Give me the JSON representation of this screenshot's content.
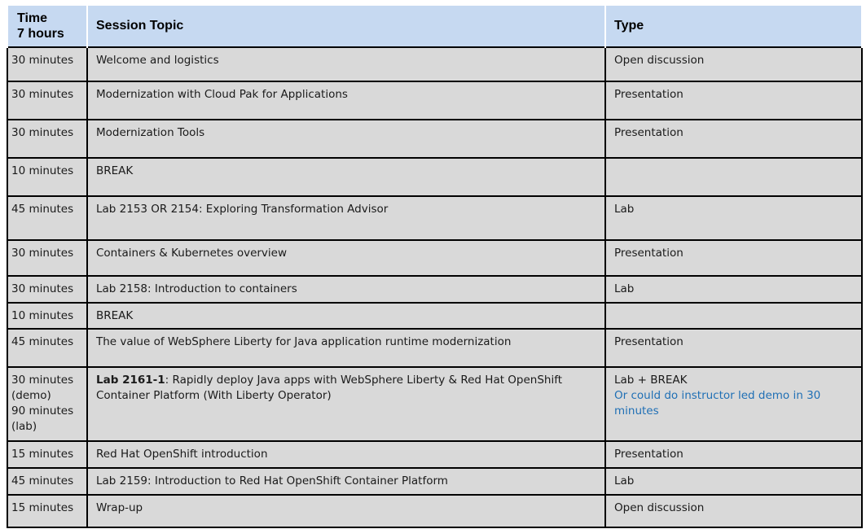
{
  "header": {
    "time_line1": "Time",
    "time_line2": "7 hours",
    "topic": "Session Topic",
    "type": "Type"
  },
  "rows": [
    {
      "time": "30 minutes",
      "topic": "Welcome and logistics",
      "type": "Open discussion"
    },
    {
      "time": "30 minutes",
      "topic": "Modernization with Cloud Pak for Applications",
      "type": "Presentation"
    },
    {
      "time": "30 minutes",
      "topic": "Modernization Tools",
      "type": "Presentation"
    },
    {
      "time": "10 minutes",
      "topic": "BREAK",
      "type": ""
    },
    {
      "time": "45 minutes",
      "topic": "Lab 2153 OR  2154: Exploring Transformation Advisor",
      "type": "Lab"
    },
    {
      "time": "30 minutes",
      "topic": "Containers & Kubernetes overview",
      "type": "Presentation"
    },
    {
      "time": "30 minutes",
      "topic": "Lab 2158: Introduction to containers",
      "type": "Lab"
    },
    {
      "time": "10 minutes",
      "topic": "BREAK",
      "type": ""
    },
    {
      "time": "45  minutes",
      "topic": "The value of WebSphere Liberty for Java application runtime modernization",
      "type": "Presentation"
    },
    {
      "time_lines": [
        "30 minutes",
        "(demo)",
        "90 minutes",
        "(lab)"
      ],
      "topic_bold": "Lab 2161-1",
      "topic_rest": ": Rapidly deploy Java apps with WebSphere Liberty & Red Hat OpenShift Container Platform (With Liberty Operator)",
      "type": "Lab + BREAK",
      "type_note": "Or could do instructor led demo in 30 minutes"
    },
    {
      "time": "15 minutes",
      "topic": "Red Hat OpenShift introduction",
      "type": "Presentation"
    },
    {
      "time": "45 minutes",
      "topic": "Lab 2159: Introduction to Red Hat OpenShift Container Platform",
      "type": "Lab"
    },
    {
      "time": "15 minutes",
      "topic": "Wrap-up",
      "type": "Open discussion"
    }
  ]
}
